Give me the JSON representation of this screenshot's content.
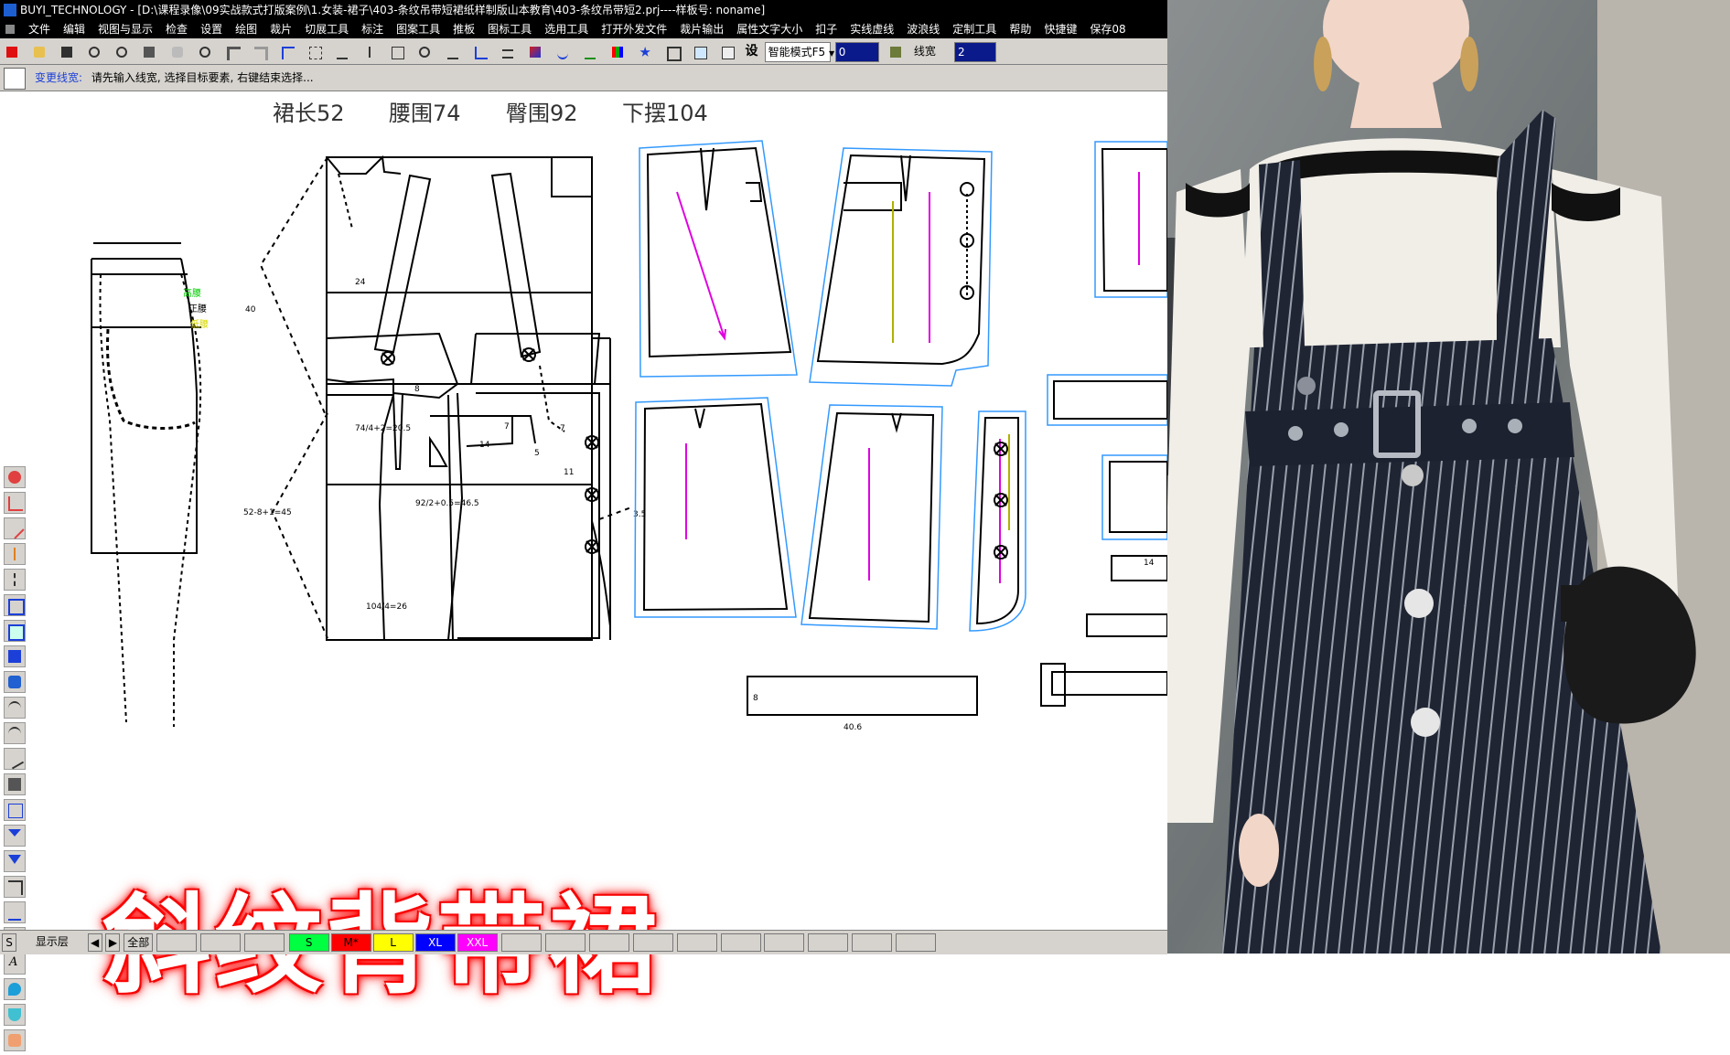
{
  "window": {
    "title": "BUYI_TECHNOLOGY - [D:\\课程录像\\09实战款式打版案例\\1.女装-裙子\\403-条纹吊带短裙纸样制版山本教育\\403-条纹吊带短2.prj----样板号: noname]"
  },
  "menu": [
    "文件",
    "编辑",
    "视图与显示",
    "检查",
    "设置",
    "绘图",
    "裁片",
    "切展工具",
    "标注",
    "图案工具",
    "推板",
    "图标工具",
    "选用工具",
    "打开外发文件",
    "裁片输出",
    "属性文字大小",
    "扣子",
    "实线虚线",
    "波浪线",
    "定制工具",
    "帮助",
    "快捷键",
    "保存08"
  ],
  "toolbar": {
    "set_label": "设",
    "mode_select": "智能模式F5",
    "value_field": "0",
    "line_width_label": "线宽",
    "line_width_value": "2"
  },
  "status": {
    "tool_name": "变更线宽:",
    "prompt": "请先输入线宽, 选择目标要素, 右键结束选择..."
  },
  "canvas": {
    "header": {
      "skirt_length": "裙长52",
      "waist": "腰围74",
      "hip": "臀围92",
      "hem": "下摆104"
    },
    "sketch_labels": {
      "waist_high": "高腰",
      "waist_normal": "正腰",
      "waist_low": "低腰"
    },
    "dims": {
      "d40": "40",
      "d24": "24",
      "d8": "8",
      "waist_calc": "74/4+2=20.5",
      "d14": "14",
      "d7a": "7",
      "d7b": "7",
      "d5": "5",
      "d11": "11",
      "hip_calc": "92/2+0.5=46.5",
      "side_calc": "52-8+1=45",
      "d35": "3.5",
      "hem_calc": "104/4=26",
      "belt_w": "8",
      "belt_l": "40.6",
      "pocket_14": "14"
    },
    "big_title": "斜纹背带裙"
  },
  "bottombar": {
    "s_label": "S",
    "layer_label": "显示层",
    "all_label": "全部",
    "sizes": [
      {
        "label": "S",
        "color": "#00ff40",
        "text_color": "#000000"
      },
      {
        "label": "M*",
        "color": "#ff0000",
        "text_color": "#000000"
      },
      {
        "label": "L",
        "color": "#ffff00",
        "text_color": "#000000"
      },
      {
        "label": "XL",
        "color": "#0000ff",
        "text_color": "#ffffff"
      },
      {
        "label": "XXL",
        "color": "#ff00ff",
        "text_color": "#ffffff"
      }
    ]
  },
  "colors": {
    "pattern_line": "#000000",
    "piece_outline": "#3399ff",
    "grain_magenta": "#e000e0",
    "grain_olive": "#b0b000",
    "marker_green": "#00cc00",
    "title_glow": "#ff0000"
  }
}
